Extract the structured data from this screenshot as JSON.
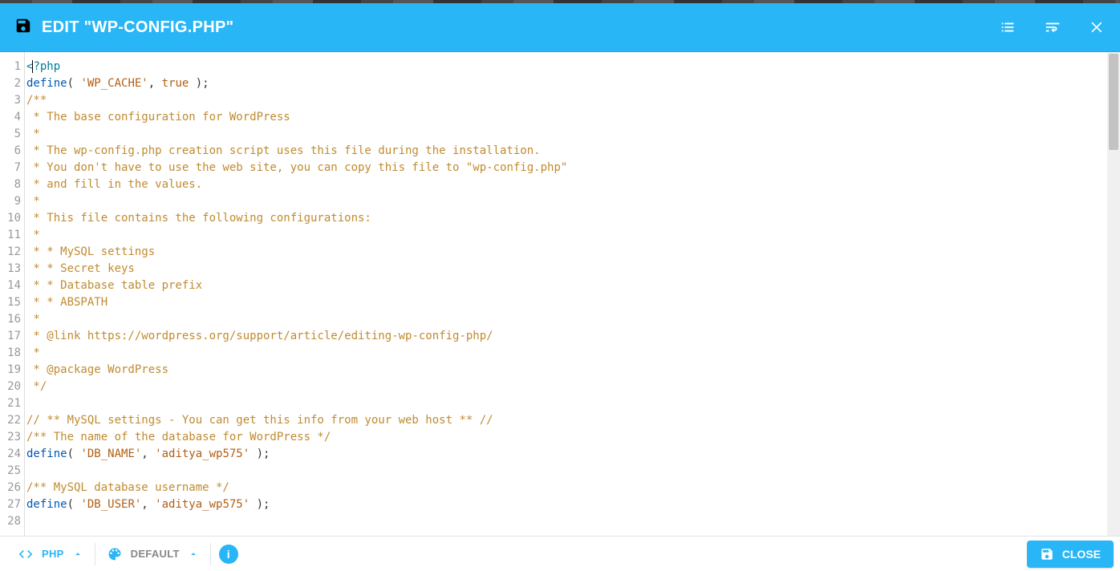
{
  "header": {
    "title": "EDIT \"WP-CONFIG.PHP\""
  },
  "bottombar": {
    "language_label": "PHP",
    "theme_label": "DEFAULT",
    "info_glyph": "i",
    "close_label": "CLOSE"
  },
  "code": {
    "lines": [
      {
        "n": 1,
        "tokens": [
          {
            "t": "<",
            "c": "tag"
          },
          {
            "t": "?php",
            "c": "tag"
          }
        ]
      },
      {
        "n": 2,
        "tokens": [
          {
            "t": "define",
            "c": "key"
          },
          {
            "t": "( ",
            "c": ""
          },
          {
            "t": "'WP_CACHE'",
            "c": "str"
          },
          {
            "t": ", ",
            "c": ""
          },
          {
            "t": "true",
            "c": "bool"
          },
          {
            "t": " );",
            "c": ""
          }
        ]
      },
      {
        "n": 3,
        "tokens": [
          {
            "t": "/**",
            "c": "com"
          }
        ]
      },
      {
        "n": 4,
        "tokens": [
          {
            "t": " * The base configuration for WordPress",
            "c": "com"
          }
        ]
      },
      {
        "n": 5,
        "tokens": [
          {
            "t": " *",
            "c": "com"
          }
        ]
      },
      {
        "n": 6,
        "tokens": [
          {
            "t": " * The wp-config.php creation script uses this file during the installation.",
            "c": "com"
          }
        ]
      },
      {
        "n": 7,
        "tokens": [
          {
            "t": " * You don't have to use the web site, you can copy this file to \"wp-config.php\"",
            "c": "com"
          }
        ]
      },
      {
        "n": 8,
        "tokens": [
          {
            "t": " * and fill in the values.",
            "c": "com"
          }
        ]
      },
      {
        "n": 9,
        "tokens": [
          {
            "t": " *",
            "c": "com"
          }
        ]
      },
      {
        "n": 10,
        "tokens": [
          {
            "t": " * This file contains the following configurations:",
            "c": "com"
          }
        ]
      },
      {
        "n": 11,
        "tokens": [
          {
            "t": " *",
            "c": "com"
          }
        ]
      },
      {
        "n": 12,
        "tokens": [
          {
            "t": " * * MySQL settings",
            "c": "com"
          }
        ]
      },
      {
        "n": 13,
        "tokens": [
          {
            "t": " * * Secret keys",
            "c": "com"
          }
        ]
      },
      {
        "n": 14,
        "tokens": [
          {
            "t": " * * Database table prefix",
            "c": "com"
          }
        ]
      },
      {
        "n": 15,
        "tokens": [
          {
            "t": " * * ABSPATH",
            "c": "com"
          }
        ]
      },
      {
        "n": 16,
        "tokens": [
          {
            "t": " *",
            "c": "com"
          }
        ]
      },
      {
        "n": 17,
        "tokens": [
          {
            "t": " * @link https://wordpress.org/support/article/editing-wp-config-php/",
            "c": "com"
          }
        ]
      },
      {
        "n": 18,
        "tokens": [
          {
            "t": " *",
            "c": "com"
          }
        ]
      },
      {
        "n": 19,
        "tokens": [
          {
            "t": " * @package WordPress",
            "c": "com"
          }
        ]
      },
      {
        "n": 20,
        "tokens": [
          {
            "t": " */",
            "c": "com"
          }
        ]
      },
      {
        "n": 21,
        "tokens": []
      },
      {
        "n": 22,
        "tokens": [
          {
            "t": "// ** MySQL settings - You can get this info from your web host ** //",
            "c": "com"
          }
        ]
      },
      {
        "n": 23,
        "tokens": [
          {
            "t": "/** The name of the database for WordPress */",
            "c": "com"
          }
        ]
      },
      {
        "n": 24,
        "tokens": [
          {
            "t": "define",
            "c": "key"
          },
          {
            "t": "( ",
            "c": ""
          },
          {
            "t": "'DB_NAME'",
            "c": "str"
          },
          {
            "t": ", ",
            "c": ""
          },
          {
            "t": "'aditya_wp575'",
            "c": "str"
          },
          {
            "t": " );",
            "c": ""
          }
        ]
      },
      {
        "n": 25,
        "tokens": []
      },
      {
        "n": 26,
        "tokens": [
          {
            "t": "/** MySQL database username */",
            "c": "com"
          }
        ]
      },
      {
        "n": 27,
        "tokens": [
          {
            "t": "define",
            "c": "key"
          },
          {
            "t": "( ",
            "c": ""
          },
          {
            "t": "'DB_USER'",
            "c": "str"
          },
          {
            "t": ", ",
            "c": ""
          },
          {
            "t": "'aditya_wp575'",
            "c": "str"
          },
          {
            "t": " );",
            "c": ""
          }
        ]
      },
      {
        "n": 28,
        "tokens": []
      }
    ]
  }
}
